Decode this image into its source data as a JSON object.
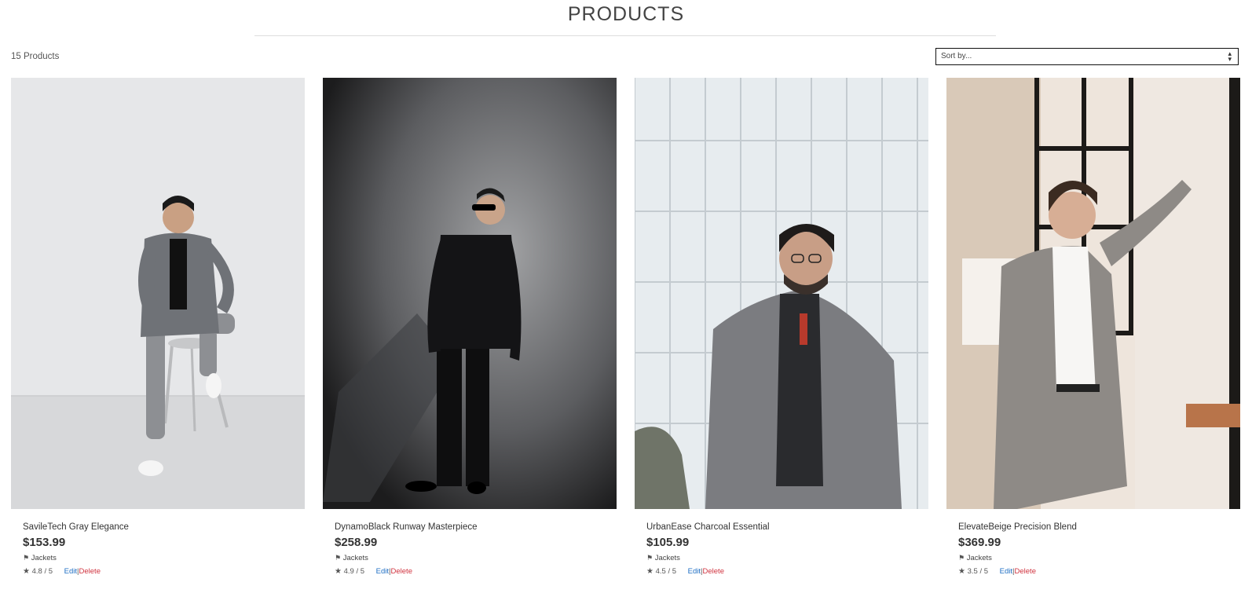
{
  "header": {
    "title": "PRODUCTS"
  },
  "toolbar": {
    "count": "15 Products",
    "sort_placeholder": "Sort by...",
    "sort_caret": "▴▾"
  },
  "icons": {
    "tag": "tag-icon",
    "star": "star-icon"
  },
  "colors": {
    "edit": "#1f6fc4",
    "delete": "#d0333f"
  },
  "products": [
    {
      "name": "SavileTech Gray Elegance",
      "price": "$153.99",
      "category": "Jackets",
      "rating": "4.8 / 5",
      "edit": "Edit",
      "sep": "|",
      "delete": "Delete"
    },
    {
      "name": "DynamoBlack Runway Masterpiece",
      "price": "$258.99",
      "category": "Jackets",
      "rating": "4.9 / 5",
      "edit": "Edit",
      "sep": "|",
      "delete": "Delete"
    },
    {
      "name": "UrbanEase Charcoal Essential",
      "price": "$105.99",
      "category": "Jackets",
      "rating": "4.5 / 5",
      "edit": "Edit",
      "sep": "|",
      "delete": "Delete"
    },
    {
      "name": "ElevateBeige Precision Blend",
      "price": "$369.99",
      "category": "Jackets",
      "rating": "3.5 / 5",
      "edit": "Edit",
      "sep": "|",
      "delete": "Delete"
    }
  ]
}
